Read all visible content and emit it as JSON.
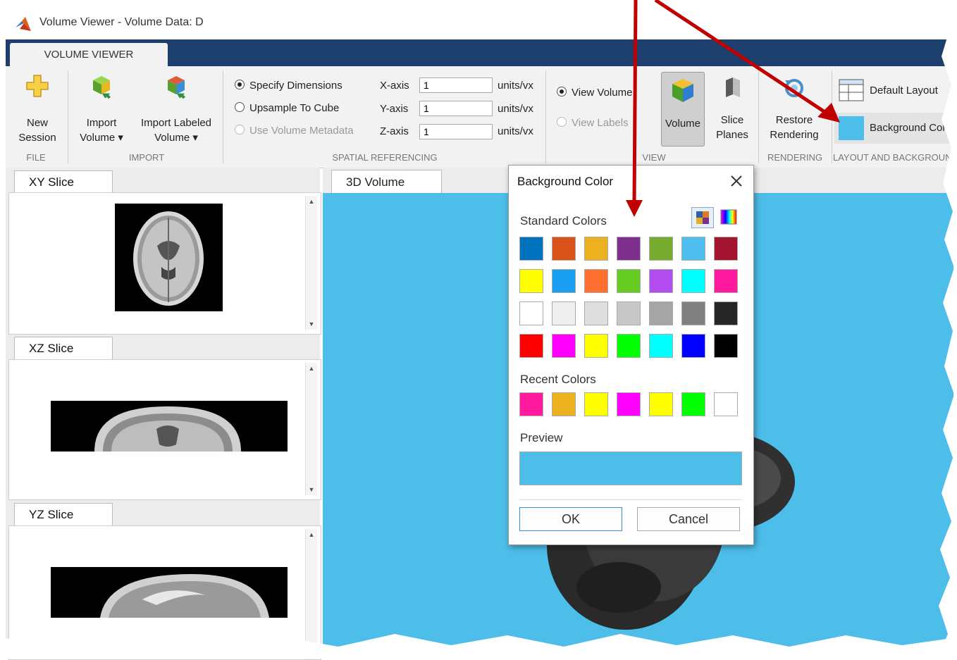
{
  "window": {
    "title": "Volume Viewer - Volume Data: D"
  },
  "tab": {
    "label": "VOLUME VIEWER"
  },
  "ribbon": {
    "file": {
      "new_session_l1": "New",
      "new_session_l2": "Session",
      "group": "FILE"
    },
    "import": {
      "import_volume_l1": "Import",
      "import_volume_l2": "Volume ▾",
      "import_labeled_l1": "Import Labeled",
      "import_labeled_l2": "Volume ▾",
      "group": "IMPORT"
    },
    "spatial": {
      "specify": "Specify Dimensions",
      "upsample": "Upsample To Cube",
      "metadata": "Use Volume Metadata",
      "xaxis": "X-axis",
      "yaxis": "Y-axis",
      "zaxis": "Z-axis",
      "xval": "1",
      "yval": "1",
      "zval": "1",
      "units": "units/vx",
      "group": "SPATIAL REFERENCING"
    },
    "view": {
      "view_volume": "View Volume",
      "view_labels": "View Labels",
      "volume": "Volume",
      "slice_l1": "Slice",
      "slice_l2": "Planes",
      "group": "VIEW"
    },
    "rendering": {
      "restore_l1": "Restore",
      "restore_l2": "Rendering",
      "group": "RENDERING"
    },
    "layout": {
      "default_layout": "Default Layout",
      "background_color": "Background Color",
      "group": "LAYOUT AND BACKGROUND"
    }
  },
  "panels": {
    "xy": "XY Slice",
    "xz": "XZ Slice",
    "yz": "YZ Slice",
    "main": "3D Volume"
  },
  "dialog": {
    "title": "Background Color",
    "standard_label": "Standard Colors",
    "recent_label": "Recent Colors",
    "preview_label": "Preview",
    "ok": "OK",
    "cancel": "Cancel",
    "preview_color": "#4dbde9",
    "standard_colors": [
      "#0072bd",
      "#d95319",
      "#edb120",
      "#7e2f8e",
      "#77ac30",
      "#4dbeee",
      "#a2142f",
      "#ffff00",
      "#1a9ff0",
      "#ff6f30",
      "#66cc22",
      "#b34df0",
      "#00ffff",
      "#ff1aa0",
      "#ffffff",
      "#efefef",
      "#dedede",
      "#c8c8c8",
      "#a5a5a5",
      "#808080",
      "#262626",
      "#ff0000",
      "#ff00ff",
      "#ffff00",
      "#00ff00",
      "#00ffff",
      "#0000ff",
      "#000000"
    ],
    "recent_colors": [
      "#ff1aa0",
      "#edb120",
      "#ffff00",
      "#ff00ff",
      "#ffff00",
      "#00ff00",
      "#ffffff"
    ]
  },
  "colors": {
    "accent": "#c00000",
    "background": "#4dbde9",
    "tabstrip": "#1d3f6e"
  }
}
